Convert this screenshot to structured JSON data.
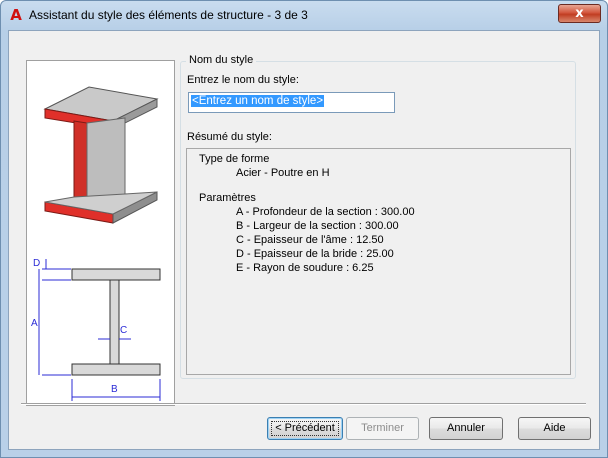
{
  "window": {
    "title": "Assistant du style des éléments de structure - 3 de 3",
    "close_glyph": "x",
    "app_icon_glyph": "A"
  },
  "group": {
    "title": "Nom du style",
    "name_label": "Entrez le nom du style:",
    "name_value": "<Entrez un nom de style>",
    "summary_label": "Résumé du style:"
  },
  "summary": {
    "shape_heading": "Type de forme",
    "shape_value": "Acier - Poutre en H",
    "params_heading": "Paramètres",
    "params": [
      "A - Profondeur de la section : 300.00",
      "B - Largeur de la section : 300.00",
      "C - Epaisseur de l'âme : 12.50",
      "D - Epaisseur de la bride : 25.00",
      "E - Rayon de soudure : 6.25"
    ]
  },
  "diagram": {
    "label_d": "D",
    "label_a": "A",
    "label_c": "C",
    "label_b": "B"
  },
  "buttons": {
    "previous": "< Précédent",
    "finish": "Terminer",
    "cancel": "Annuler",
    "help": "Aide"
  },
  "colors": {
    "flange_red": "#e0302a",
    "dimension_blue": "#2b2bd6",
    "selection": "#3399ff"
  }
}
